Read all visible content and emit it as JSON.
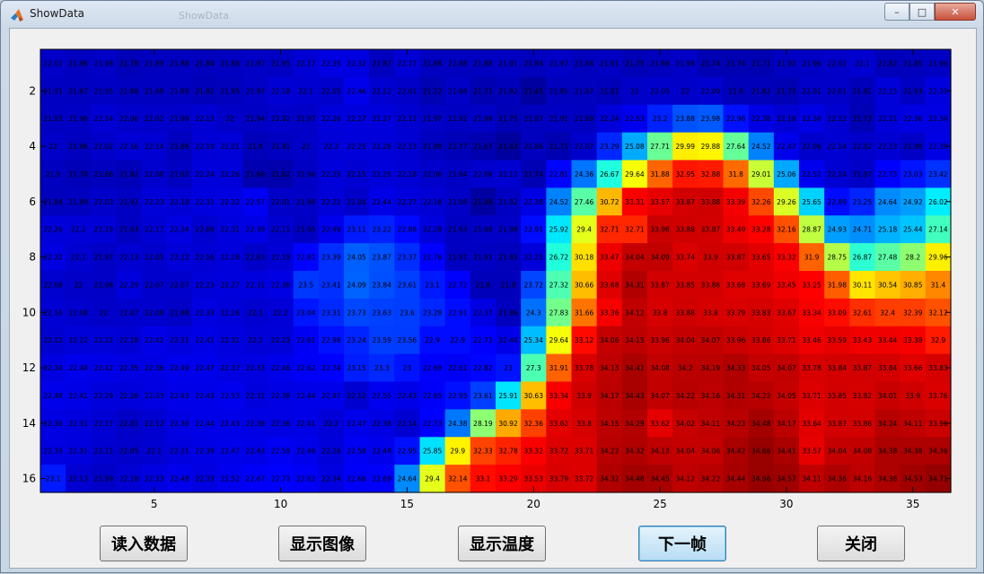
{
  "window": {
    "title": "ShowData",
    "ghost_title": "ShowData"
  },
  "controls": {
    "minimize": "–",
    "maximize": "□",
    "close": "✕"
  },
  "buttons": [
    {
      "id": "load",
      "label": "读入数据"
    },
    {
      "id": "image",
      "label": "显示图像"
    },
    {
      "id": "temp",
      "label": "显示温度"
    },
    {
      "id": "next",
      "label": "下一帧"
    },
    {
      "id": "close",
      "label": "关闭"
    }
  ],
  "chart_data": {
    "type": "heatmap",
    "title": "",
    "xlabel": "",
    "ylabel": "",
    "cols": 36,
    "rows": 16,
    "xlim": [
      0.5,
      36.5
    ],
    "ylim": [
      0.5,
      16.5
    ],
    "xticks": [
      5,
      10,
      15,
      20,
      25,
      30,
      35
    ],
    "yticks": [
      2,
      4,
      6,
      8,
      10,
      12,
      14,
      16
    ],
    "colormap": "jet",
    "clim": [
      21,
      35
    ],
    "values": [
      [
        22.01,
        21.86,
        21.98,
        21.78,
        21.89,
        21.88,
        21.84,
        21.88,
        21.97,
        21.95,
        22.17,
        22.35,
        22.32,
        21.87,
        22.17,
        21.88,
        21.88,
        21.88,
        21.91,
        21.84,
        21.97,
        21.84,
        21.91,
        21.75,
        21.86,
        21.98,
        21.74,
        21.74,
        21.71,
        21.92,
        21.96,
        22.01,
        22.1,
        21.82,
        21.85,
        21.96
      ],
      [
        21.91,
        21.87,
        21.95,
        21.88,
        21.88,
        21.89,
        21.82,
        21.85,
        21.97,
        22.18,
        22.1,
        22.05,
        22.46,
        22.12,
        22.01,
        21.72,
        21.98,
        21.71,
        21.82,
        21.45,
        21.85,
        21.87,
        21.82,
        22.0,
        22.05,
        22.0,
        22.09,
        21.8,
        21.82,
        21.73,
        22.01,
        22.01,
        21.81,
        22.23,
        21.93,
        22.31
      ],
      [
        21.93,
        21.96,
        22.14,
        22.06,
        22.02,
        21.99,
        22.13,
        22.0,
        21.94,
        22.02,
        21.97,
        22.26,
        22.27,
        22.27,
        22.11,
        21.97,
        21.92,
        21.98,
        21.75,
        21.87,
        21.91,
        21.89,
        22.24,
        22.53,
        23.2,
        23.88,
        23.98,
        22.98,
        22.38,
        22.18,
        22.38,
        22.12,
        21.73,
        22.21,
        22.36,
        22.34
      ],
      [
        22.0,
        21.86,
        22.02,
        22.16,
        22.14,
        21.86,
        22.19,
        22.21,
        21.8,
        21.91,
        22.0,
        22.2,
        22.25,
        22.26,
        22.13,
        21.89,
        21.77,
        21.67,
        21.43,
        21.86,
        21.71,
        22.07,
        23.29,
        25.08,
        27.71,
        29.99,
        29.88,
        27.64,
        24.52,
        22.47,
        22.06,
        22.14,
        22.02,
        22.13,
        21.98,
        22.39
      ],
      [
        21.9,
        21.78,
        21.86,
        21.82,
        22.08,
        21.92,
        22.24,
        22.26,
        21.68,
        21.62,
        21.96,
        22.25,
        22.15,
        22.25,
        22.18,
        22.06,
        21.94,
        22.08,
        22.12,
        21.74,
        22.81,
        24.36,
        26.67,
        29.64,
        31.88,
        32.95,
        32.88,
        31.8,
        29.01,
        25.06,
        22.52,
        22.14,
        21.97,
        22.73,
        23.03,
        23.42
      ],
      [
        21.84,
        21.89,
        22.03,
        21.92,
        22.23,
        22.18,
        22.31,
        22.32,
        22.57,
        22.01,
        21.98,
        22.22,
        22.04,
        22.44,
        22.27,
        22.18,
        21.98,
        21.48,
        21.92,
        22.38,
        24.52,
        27.46,
        30.72,
        33.31,
        33.57,
        33.87,
        33.88,
        33.39,
        32.26,
        29.26,
        25.65,
        22.89,
        23.25,
        24.64,
        24.92,
        26.02
      ],
      [
        22.26,
        22.2,
        22.19,
        21.93,
        22.17,
        22.34,
        22.09,
        22.31,
        22.39,
        22.11,
        21.95,
        22.49,
        23.11,
        23.22,
        22.88,
        22.28,
        21.93,
        21.98,
        21.98,
        22.91,
        25.92,
        29.4,
        32.71,
        32.71,
        33.96,
        33.88,
        33.87,
        33.49,
        33.28,
        32.16,
        28.87,
        24.93,
        24.71,
        25.18,
        25.44,
        27.14
      ],
      [
        22.32,
        22.1,
        21.97,
        22.13,
        22.05,
        22.22,
        22.16,
        22.28,
        22.03,
        22.19,
        22.81,
        23.39,
        24.05,
        23.87,
        23.37,
        22.76,
        21.91,
        21.91,
        21.85,
        22.25,
        26.72,
        30.18,
        33.47,
        34.04,
        34.09,
        33.74,
        33.9,
        33.87,
        33.65,
        33.32,
        31.9,
        28.75,
        26.87,
        27.48,
        28.2,
        29.96
      ],
      [
        22.08,
        22.0,
        21.98,
        22.29,
        22.07,
        22.07,
        22.23,
        22.27,
        22.31,
        22.38,
        23.5,
        23.41,
        24.09,
        23.84,
        23.61,
        23.1,
        22.72,
        21.8,
        21.8,
        23.72,
        27.32,
        30.66,
        33.68,
        34.31,
        33.87,
        33.85,
        33.86,
        33.68,
        33.69,
        33.45,
        33.25,
        31.98,
        30.11,
        30.54,
        30.85,
        31.4
      ],
      [
        22.16,
        22.08,
        22.0,
        22.07,
        22.08,
        21.98,
        22.33,
        22.26,
        22.1,
        22.2,
        23.04,
        23.31,
        23.73,
        23.63,
        23.6,
        23.28,
        22.91,
        22.37,
        21.86,
        24.3,
        27.83,
        31.66,
        33.36,
        34.12,
        33.8,
        33.88,
        33.8,
        33.79,
        33.83,
        33.67,
        33.34,
        33.09,
        32.61,
        32.4,
        32.39,
        32.12
      ],
      [
        22.12,
        22.22,
        22.22,
        22.18,
        22.42,
        22.31,
        22.41,
        22.31,
        22.2,
        22.23,
        22.61,
        22.98,
        23.24,
        23.59,
        23.56,
        22.9,
        22.9,
        22.71,
        22.44,
        25.34,
        29.64,
        33.12,
        34.06,
        34.15,
        33.96,
        34.04,
        34.07,
        33.96,
        33.86,
        33.71,
        33.46,
        33.59,
        33.43,
        33.44,
        33.38,
        32.9
      ],
      [
        22.34,
        22.48,
        22.42,
        22.35,
        22.36,
        22.49,
        22.47,
        22.37,
        22.33,
        22.46,
        22.62,
        22.74,
        23.15,
        23.3,
        23.0,
        22.69,
        22.61,
        22.82,
        23.0,
        27.3,
        31.91,
        33.78,
        34.13,
        34.41,
        34.08,
        34.2,
        34.19,
        34.33,
        34.05,
        34.07,
        33.78,
        33.84,
        33.87,
        33.84,
        33.66,
        33.83
      ],
      [
        22.48,
        22.41,
        22.29,
        22.26,
        22.33,
        22.43,
        22.43,
        22.53,
        22.31,
        22.38,
        22.44,
        22.47,
        22.12,
        22.55,
        22.43,
        22.65,
        22.95,
        23.61,
        25.91,
        30.63,
        33.34,
        33.9,
        34.17,
        34.43,
        34.07,
        34.22,
        34.16,
        34.31,
        34.22,
        34.05,
        33.71,
        33.85,
        33.82,
        34.01,
        33.9,
        33.76
      ],
      [
        22.36,
        22.31,
        22.17,
        22.01,
        22.12,
        22.36,
        22.44,
        22.43,
        22.38,
        22.36,
        22.41,
        22.2,
        22.47,
        22.38,
        22.14,
        22.73,
        24.38,
        28.19,
        30.92,
        32.36,
        33.62,
        33.8,
        34.15,
        34.29,
        33.62,
        34.02,
        34.11,
        34.23,
        34.48,
        34.17,
        33.64,
        33.87,
        33.86,
        34.24,
        34.11,
        33.96
      ],
      [
        22.33,
        22.31,
        22.11,
        22.05,
        22.1,
        22.31,
        22.39,
        22.47,
        22.43,
        22.59,
        22.46,
        22.26,
        22.58,
        22.48,
        22.95,
        25.85,
        29.9,
        32.33,
        32.78,
        33.32,
        33.72,
        33.71,
        34.22,
        34.32,
        34.13,
        34.04,
        34.06,
        34.42,
        34.66,
        34.41,
        33.57,
        34.04,
        34.08,
        34.38,
        34.38,
        34.36
      ],
      [
        23.1,
        22.13,
        21.99,
        22.18,
        22.33,
        22.48,
        22.33,
        22.52,
        22.67,
        22.73,
        22.62,
        22.34,
        22.66,
        22.69,
        24.64,
        29.4,
        32.14,
        33.1,
        33.29,
        33.53,
        33.79,
        33.72,
        34.32,
        34.48,
        34.45,
        34.12,
        34.22,
        34.44,
        34.66,
        34.57,
        34.11,
        34.36,
        34.16,
        34.38,
        34.53,
        34.71
      ]
    ]
  }
}
